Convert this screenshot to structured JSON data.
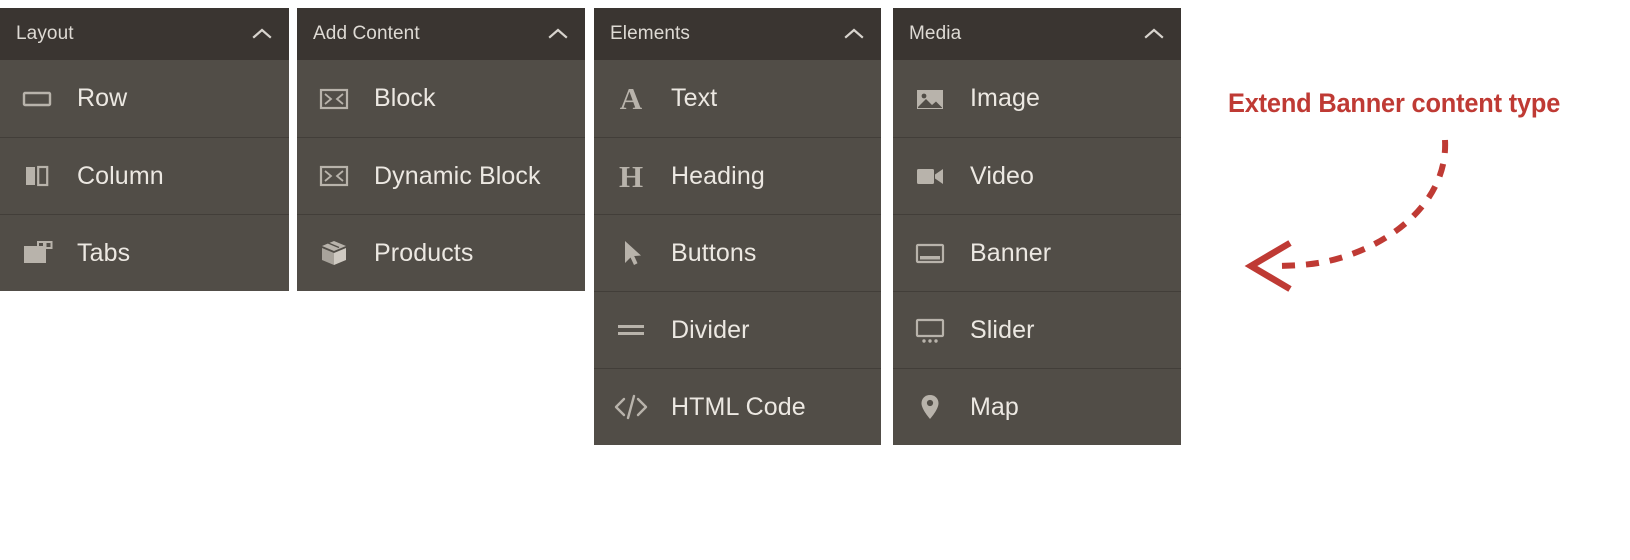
{
  "panels": [
    {
      "id": "layout",
      "title": "Layout",
      "collapse_icon": "chevron-up-icon",
      "items": [
        {
          "label": "Row",
          "icon": "row-icon"
        },
        {
          "label": "Column",
          "icon": "column-icon"
        },
        {
          "label": "Tabs",
          "icon": "tabs-icon"
        }
      ]
    },
    {
      "id": "add-content",
      "title": "Add Content",
      "collapse_icon": "chevron-up-icon",
      "items": [
        {
          "label": "Block",
          "icon": "block-icon"
        },
        {
          "label": "Dynamic Block",
          "icon": "dynamic-block-icon"
        },
        {
          "label": "Products",
          "icon": "products-box-icon"
        }
      ]
    },
    {
      "id": "elements",
      "title": "Elements",
      "collapse_icon": "chevron-up-icon",
      "items": [
        {
          "label": "Text",
          "icon": "text-a-icon"
        },
        {
          "label": "Heading",
          "icon": "heading-h-icon"
        },
        {
          "label": "Buttons",
          "icon": "cursor-arrow-icon"
        },
        {
          "label": "Divider",
          "icon": "divider-lines-icon"
        },
        {
          "label": "HTML Code",
          "icon": "html-code-icon"
        }
      ]
    },
    {
      "id": "media",
      "title": "Media",
      "collapse_icon": "chevron-up-icon",
      "items": [
        {
          "label": "Image",
          "icon": "image-icon"
        },
        {
          "label": "Video",
          "icon": "video-camera-icon"
        },
        {
          "label": "Banner",
          "icon": "banner-icon"
        },
        {
          "label": "Slider",
          "icon": "slider-icon"
        },
        {
          "label": "Map",
          "icon": "map-pin-icon"
        }
      ]
    }
  ],
  "annotation": {
    "text": "Extend Banner content type",
    "color": "#bf3a34",
    "arrow": "dashed-curved-arrow-left"
  },
  "colors": {
    "panel_header_bg": "#3a3531",
    "panel_body_bg": "#514d47",
    "divider": "#423e39",
    "label_text": "#ece8e2",
    "icon": "#b8b3ab",
    "annotation_red": "#bf3a34",
    "page_bg": "#ffffff"
  }
}
